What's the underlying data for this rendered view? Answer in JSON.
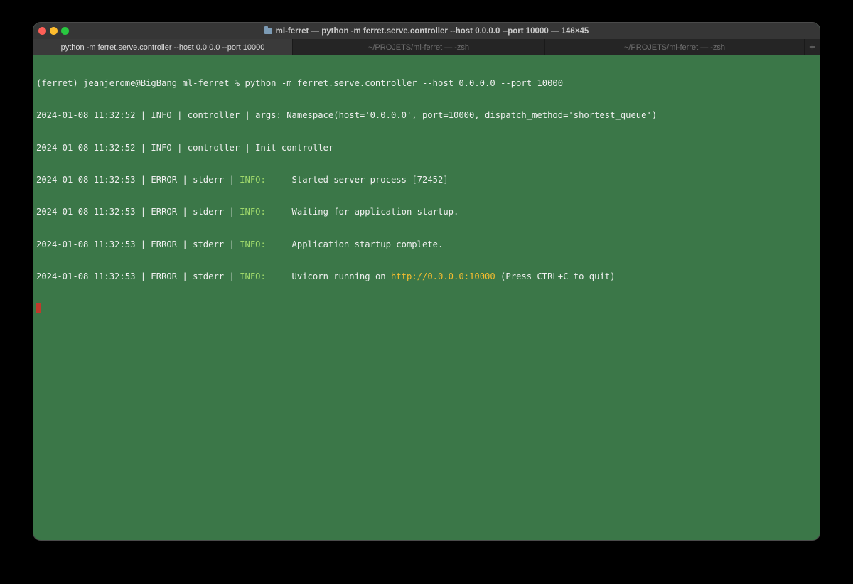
{
  "window": {
    "title": "ml-ferret — python -m ferret.serve.controller --host 0.0.0.0 --port 10000 — 146×45"
  },
  "tabs": [
    {
      "label": "python -m ferret.serve.controller --host 0.0.0.0 --port 10000",
      "active": true
    },
    {
      "label": "~/PROJETS/ml-ferret — -zsh",
      "active": false
    },
    {
      "label": "~/PROJETS/ml-ferret — -zsh",
      "active": false
    }
  ],
  "new_tab_label": "+",
  "terminal": {
    "prompt": "(ferret) jeanjerome@BigBang ml-ferret % python -m ferret.serve.controller --host 0.0.0.0 --port 10000",
    "logs": [
      {
        "prefix": "2024-01-08 11:32:52 | INFO | controller | args: Namespace(host='0.0.0.0', port=10000, dispatch_method='shortest_queue')"
      },
      {
        "prefix": "2024-01-08 11:32:52 | INFO | controller | Init controller"
      },
      {
        "prefix": "2024-01-08 11:32:53 | ERROR | stderr | ",
        "level": "INFO:",
        "message": "     Started server process [72452]"
      },
      {
        "prefix": "2024-01-08 11:32:53 | ERROR | stderr | ",
        "level": "INFO:",
        "message": "     Waiting for application startup."
      },
      {
        "prefix": "2024-01-08 11:32:53 | ERROR | stderr | ",
        "level": "INFO:",
        "message": "     Application startup complete."
      },
      {
        "prefix": "2024-01-08 11:32:53 | ERROR | stderr | ",
        "level": "INFO:",
        "message": "     Uvicorn running on ",
        "url": "http://0.0.0.0:10000",
        "suffix": " (Press CTRL+C to quit)"
      }
    ]
  },
  "colors": {
    "terminal_bg": "#3b7748",
    "info_green": "#9fd86b",
    "url_yellow": "#f5bd2f",
    "cursor_red": "#c0392b"
  }
}
